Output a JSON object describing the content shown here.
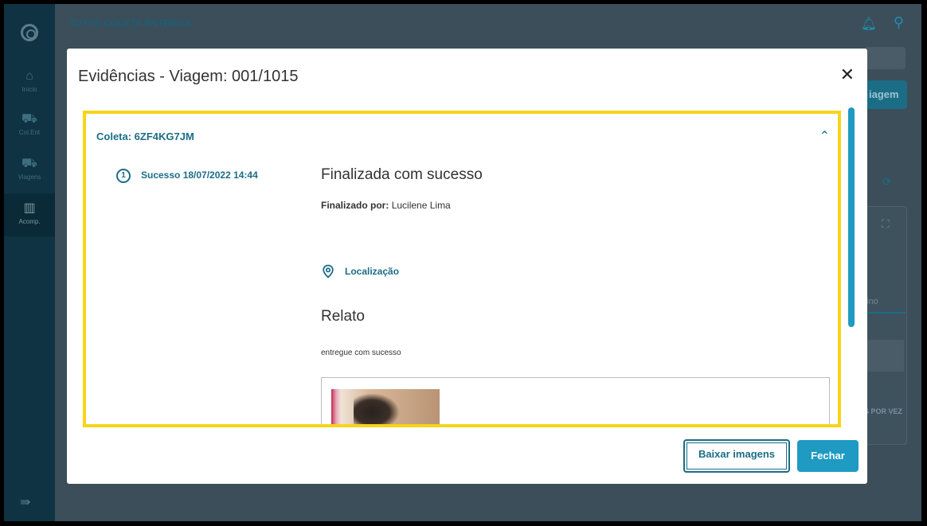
{
  "app": {
    "title": "TOTVS COLETA ENTREGA"
  },
  "sidebar": {
    "items": [
      {
        "label": "Início",
        "icon": "home-icon"
      },
      {
        "label": "Col.Ent",
        "icon": "truck-pickup-icon"
      },
      {
        "label": "Viagens",
        "icon": "truck-icon"
      },
      {
        "label": "Acomp.",
        "icon": "map-icon"
      }
    ]
  },
  "background": {
    "button_partial": "iagem",
    "tab_partial": "tino",
    "per_page_partial": "S POR VEZ"
  },
  "modal": {
    "title": "Evidências - Viagem: 001/1015",
    "coleta_label": "Coleta: 6ZF4KG7JM",
    "step_number": "1",
    "step_label": "Sucesso 18/07/2022 14:44",
    "status_title": "Finalizada com sucesso",
    "finalizado_label": "Finalizado por:",
    "finalizado_value": "Lucilene Lima",
    "location_label": "Localização",
    "relato_title": "Relato",
    "relato_text": "entregue com sucesso",
    "buttons": {
      "download": "Baixar imagens",
      "close": "Fechar"
    }
  },
  "colors": {
    "accent": "#1f9ac2",
    "highlight": "#f7d417",
    "sidebar": "#0f3342"
  }
}
